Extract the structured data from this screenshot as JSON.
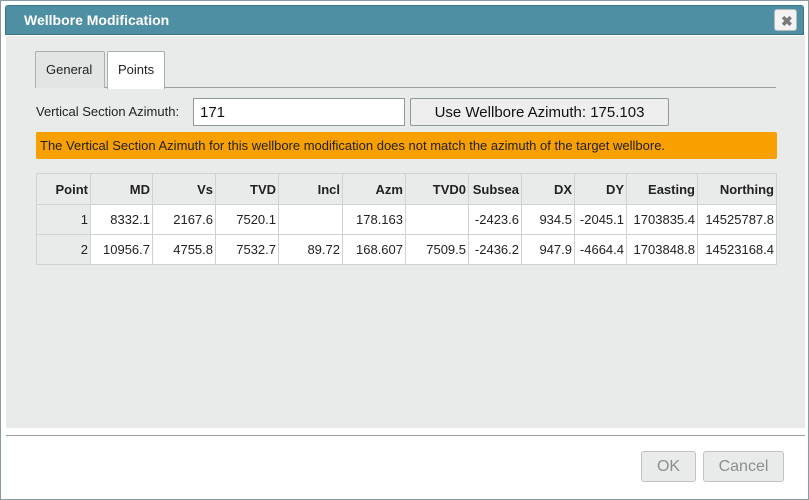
{
  "window": {
    "title": "Wellbore Modification",
    "close_glyph": "✖"
  },
  "tabs": [
    {
      "label": "General",
      "active": false
    },
    {
      "label": "Points",
      "active": true
    }
  ],
  "vertical_section": {
    "label": "Vertical Section Azimuth:",
    "value": "171",
    "use_button_label": "Use Wellbore Azimuth: 175.103"
  },
  "warning": {
    "text": "The Vertical Section Azimuth for this wellbore modification does not match the azimuth of the target wellbore.",
    "color": "#f8a000"
  },
  "table": {
    "columns": [
      "Point",
      "MD",
      "Vs",
      "TVD",
      "Incl",
      "Azm",
      "TVD0",
      "Subsea",
      "DX",
      "DY",
      "Easting",
      "Northing"
    ],
    "rows": [
      [
        "1",
        "8332.1",
        "2167.6",
        "7520.1",
        "",
        "178.163",
        "",
        "-2423.6",
        "934.5",
        "-2045.1",
        "1703835.4",
        "14525787.8"
      ],
      [
        "2",
        "10956.7",
        "4755.8",
        "7532.7",
        "89.72",
        "168.607",
        "7509.5",
        "-2436.2",
        "947.9",
        "-4664.4",
        "1703848.8",
        "14523168.4"
      ]
    ]
  },
  "footer": {
    "ok_label": "OK",
    "cancel_label": "Cancel"
  },
  "colors": {
    "titlebar": "#4f8fa3",
    "panel": "#e9ebea"
  }
}
